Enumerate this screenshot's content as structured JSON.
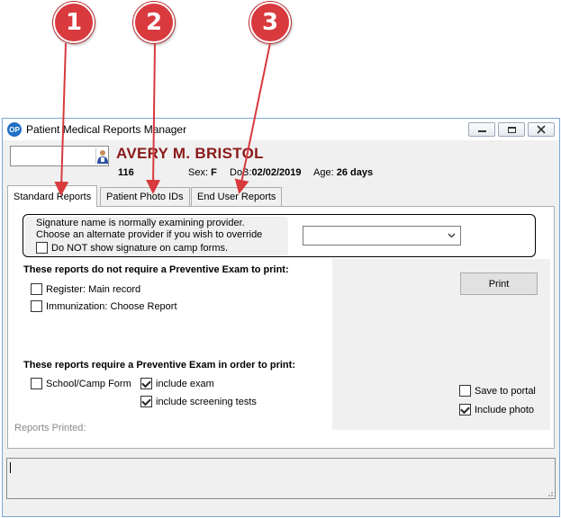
{
  "callouts": [
    "1",
    "2",
    "3"
  ],
  "window": {
    "title": "Patient Medical Reports Manager"
  },
  "patient": {
    "id_value": "",
    "name": "AVERY M. BRISTOL",
    "number": "116",
    "sex_label": "Sex:",
    "sex": "F",
    "dob_label": "DoB:",
    "dob": "02/02/2019",
    "age_label": "Age:",
    "age": "26 days"
  },
  "tabs": [
    {
      "label": "Standard Reports",
      "active": true
    },
    {
      "label": "Patient Photo IDs",
      "active": false
    },
    {
      "label": "End User Reports",
      "active": false
    }
  ],
  "signature": {
    "line1": "Signature name is normally examining provider.",
    "line2": "Choose an alternate provider if you wish to override",
    "no_signature_label": "Do NOT show signature on camp forms.",
    "no_signature_checked": false,
    "provider_selected": ""
  },
  "no_exam_section": {
    "title": "These reports do not require a Preventive Exam to print:",
    "items": [
      {
        "label": "Register: Main record",
        "checked": false
      },
      {
        "label": "Immunization: Choose Report",
        "checked": false
      }
    ]
  },
  "exam_section": {
    "title": "These reports require a Preventive Exam in order to print:",
    "school_camp": {
      "label": "School/Camp Form",
      "checked": false
    },
    "include_exam": {
      "label": "include exam",
      "checked": true
    },
    "include_screening": {
      "label": "include screening tests",
      "checked": true
    }
  },
  "actions": {
    "print_label": "Print",
    "save_portal": {
      "label": "Save to portal",
      "checked": false
    },
    "include_photo": {
      "label": "Include photo",
      "checked": true
    }
  },
  "reports_printed_label": "Reports Printed:",
  "log_text": "",
  "colors": {
    "callout": "#d83a3e",
    "patient_name": "#8b1a1a",
    "window_border": "#7aa7d8"
  }
}
